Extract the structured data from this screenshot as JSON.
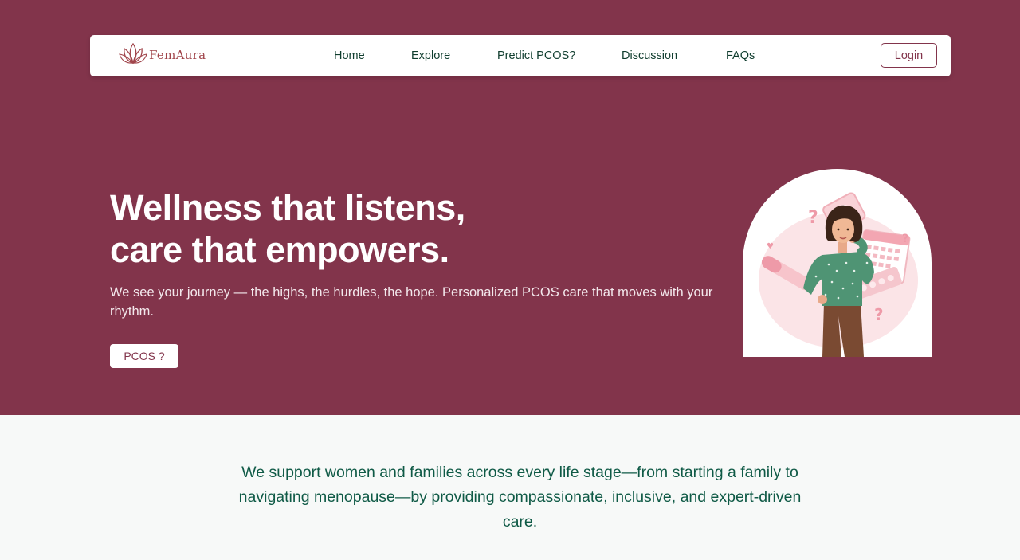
{
  "brand": {
    "name": "FemAura",
    "logo_icon": "lotus-icon",
    "color": "#a0444a"
  },
  "nav": {
    "items": [
      {
        "label": "Home"
      },
      {
        "label": "Explore"
      },
      {
        "label": "Predict PCOS?"
      },
      {
        "label": "Discussion"
      },
      {
        "label": "FAQs"
      }
    ],
    "login_label": "Login"
  },
  "hero": {
    "headline_line1": "Wellness that listens,",
    "headline_line2": "care that empowers.",
    "subtext": "We see your journey — the highs, the hurdles, the hope. Personalized PCOS care that moves with your rhythm.",
    "cta_label": "PCOS ?",
    "illustration": "woman-thinking-pcos-illustration"
  },
  "mission": {
    "text": "We support women and families across every life stage—from starting a family to navigating menopause—by providing compassionate, inclusive, and expert-driven care."
  },
  "colors": {
    "hero_background": "#82344b",
    "accent": "#82344b",
    "mission_text": "#0f5a46",
    "nav_text": "#0f3d2e",
    "page_background": "#f7f9f8"
  }
}
